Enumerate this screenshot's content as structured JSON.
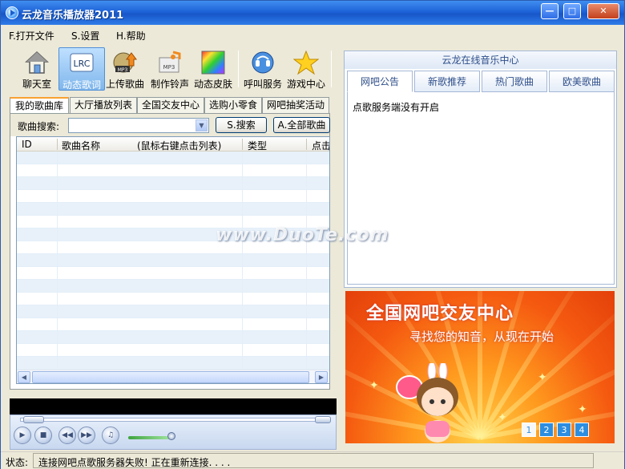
{
  "window": {
    "title": "云龙音乐播放器2011"
  },
  "menu": [
    {
      "label": "F.打开文件"
    },
    {
      "label": "S.设置"
    },
    {
      "label": "H.帮助"
    }
  ],
  "toolbar": [
    {
      "label": "聊天室",
      "icon": "home-icon"
    },
    {
      "label": "动态歌词",
      "icon": "lrc-icon",
      "badge": "LRC",
      "active": true
    },
    {
      "label": "上传歌曲",
      "icon": "upload-mp3-icon",
      "badge": "MP3"
    },
    {
      "label": "制作铃声",
      "icon": "ringtone-mp3-icon",
      "badge": "MP3"
    },
    {
      "label": "动态皮肤",
      "icon": "skin-color-icon"
    },
    {
      "label": "呼叫服务",
      "icon": "call-service-icon"
    },
    {
      "label": "游戏中心",
      "icon": "star-icon"
    }
  ],
  "tabs": [
    "我的歌曲库",
    "大厅播放列表",
    "全国交友中心",
    "选购小零食",
    "网吧抽奖活动"
  ],
  "search": {
    "label": "歌曲搜索:",
    "value": "",
    "search_button": "S.搜索",
    "all_button": "A.全部歌曲"
  },
  "table": {
    "columns": [
      "ID",
      "歌曲名称",
      "(鼠标右键点击列表)",
      "类型",
      "点击"
    ]
  },
  "right": {
    "header": "云龙在线音乐中心",
    "tabs": [
      "网吧公告",
      "新歌推荐",
      "热门歌曲",
      "欧美歌曲"
    ],
    "content": "点歌服务端没有开启"
  },
  "banner": {
    "title": "全国网吧交友中心",
    "subtitle": "寻找您的知音，从现在开始",
    "pages": [
      "1",
      "2",
      "3",
      "4"
    ]
  },
  "watermark": "www.DuoTe.com",
  "status": {
    "label": "状态:",
    "text": "连接网吧点歌服务器失败! 正在重新连接. . . ."
  }
}
